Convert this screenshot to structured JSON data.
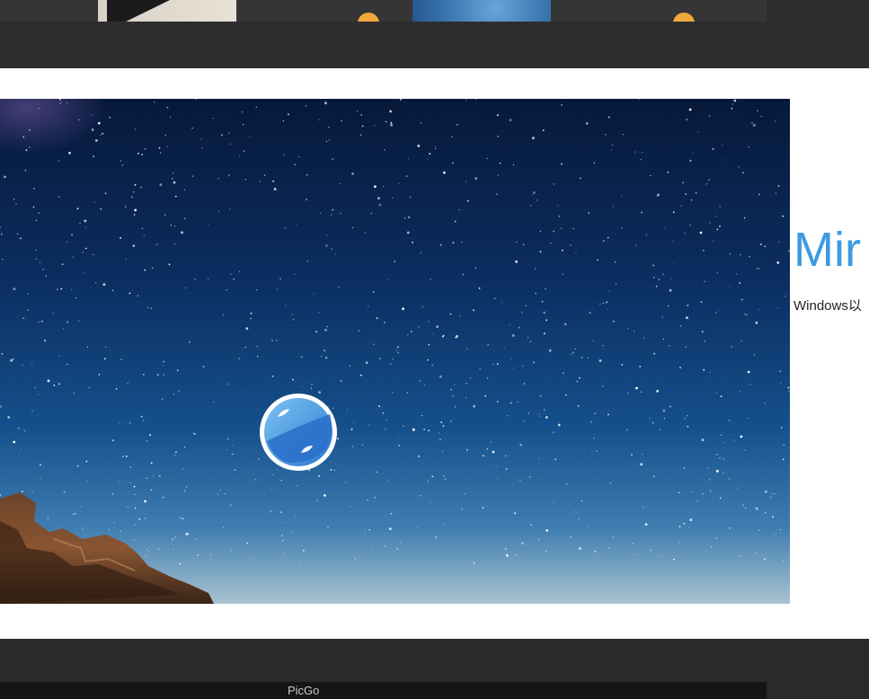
{
  "hero": {
    "title": "Mir",
    "description": "Windows以"
  },
  "bottom_bar": {
    "label": "PicGo"
  },
  "colors": {
    "accent": "#3d9be0",
    "dark_strip": "#2d2d2d",
    "orange_icon": "#f2a93b"
  },
  "icons": {
    "app_logo": "picgo-planet-icon",
    "thumbnail_overlay": "orange-bubble-icon"
  }
}
